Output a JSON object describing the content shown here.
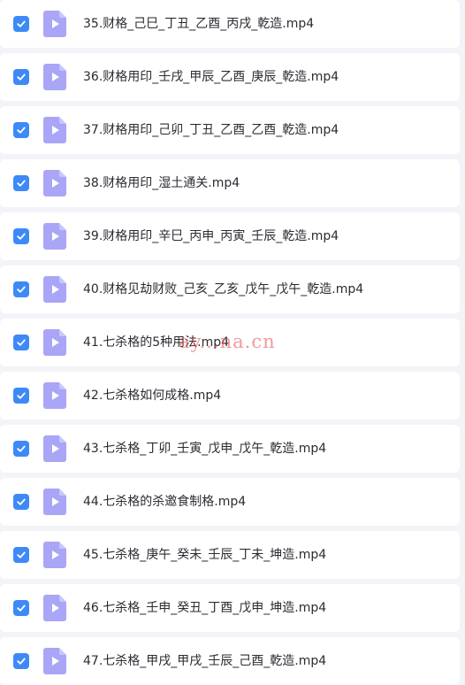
{
  "theme": {
    "checkbox_color": "#3d8af7",
    "file_icon_color": "#a9a5f7",
    "row_background": "#ffffff",
    "page_background": "#f3f4f8"
  },
  "watermark": "ay...na.cn",
  "files": [
    {
      "name": "35.财格_己巳_丁丑_乙酉_丙戌_乾造.mp4",
      "checked": true,
      "icon": "video-file-icon"
    },
    {
      "name": "36.财格用印_壬戌_甲辰_乙酉_庚辰_乾造.mp4",
      "checked": true,
      "icon": "video-file-icon"
    },
    {
      "name": "37.财格用印_己卯_丁丑_乙酉_乙酉_乾造.mp4",
      "checked": true,
      "icon": "video-file-icon"
    },
    {
      "name": "38.财格用印_湿土通关.mp4",
      "checked": true,
      "icon": "video-file-icon"
    },
    {
      "name": "39.财格用印_辛巳_丙申_丙寅_壬辰_乾造.mp4",
      "checked": true,
      "icon": "video-file-icon"
    },
    {
      "name": "40.财格见劫财败_己亥_乙亥_戊午_戊午_乾造.mp4",
      "checked": true,
      "icon": "video-file-icon"
    },
    {
      "name": "41.七杀格的5种用法.mp4",
      "checked": true,
      "icon": "video-file-icon"
    },
    {
      "name": "42.七杀格如何成格.mp4",
      "checked": true,
      "icon": "video-file-icon"
    },
    {
      "name": "43.七杀格_丁卯_壬寅_戊申_戊午_乾造.mp4",
      "checked": true,
      "icon": "video-file-icon"
    },
    {
      "name": "44.七杀格的杀邀食制格.mp4",
      "checked": true,
      "icon": "video-file-icon"
    },
    {
      "name": "45.七杀格_庚午_癸未_壬辰_丁未_坤造.mp4",
      "checked": true,
      "icon": "video-file-icon"
    },
    {
      "name": "46.七杀格_壬申_癸丑_丁酉_戊申_坤造.mp4",
      "checked": true,
      "icon": "video-file-icon"
    },
    {
      "name": "47.七杀格_甲戌_甲戌_壬辰_己酉_乾造.mp4",
      "checked": true,
      "icon": "video-file-icon"
    }
  ]
}
